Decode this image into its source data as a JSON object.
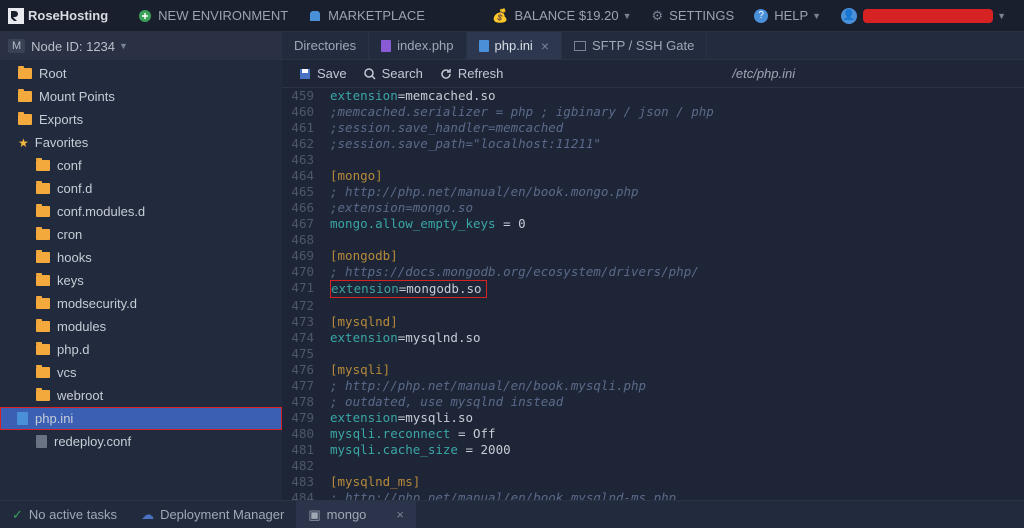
{
  "topbar": {
    "brand": "RoseHosting",
    "newEnv": "NEW ENVIRONMENT",
    "marketplace": "MARKETPLACE",
    "balanceLabel": "BALANCE $19.20",
    "settings": "SETTINGS",
    "help": "HELP"
  },
  "leftPanel": {
    "nodeChip": "M",
    "nodeLabel": "Node ID: 1234",
    "items": [
      {
        "type": "folder",
        "label": "Root",
        "level": 0
      },
      {
        "type": "folder",
        "label": "Mount Points",
        "level": 0
      },
      {
        "type": "folder",
        "label": "Exports",
        "level": 0
      },
      {
        "type": "fav",
        "label": "Favorites",
        "level": 0
      },
      {
        "type": "folder",
        "label": "conf",
        "level": 1
      },
      {
        "type": "folder",
        "label": "conf.d",
        "level": 1
      },
      {
        "type": "folder",
        "label": "conf.modules.d",
        "level": 1
      },
      {
        "type": "folder",
        "label": "cron",
        "level": 1
      },
      {
        "type": "folder",
        "label": "hooks",
        "level": 1
      },
      {
        "type": "folder",
        "label": "keys",
        "level": 1
      },
      {
        "type": "folder",
        "label": "modsecurity.d",
        "level": 1
      },
      {
        "type": "folder",
        "label": "modules",
        "level": 1
      },
      {
        "type": "folder",
        "label": "php.d",
        "level": 1
      },
      {
        "type": "folder",
        "label": "vcs",
        "level": 1
      },
      {
        "type": "folder",
        "label": "webroot",
        "level": 1
      },
      {
        "type": "file-blue",
        "label": "php.ini",
        "level": 1,
        "selected": true,
        "redbox": true
      },
      {
        "type": "file-grey",
        "label": "redeploy.conf",
        "level": 1
      }
    ]
  },
  "tabs": [
    {
      "label": "Directories",
      "icon": null
    },
    {
      "label": "index.php",
      "icon": "php"
    },
    {
      "label": "php.ini",
      "icon": "blue",
      "active": true,
      "closable": true
    },
    {
      "label": "SFTP / SSH Gate",
      "icon": "monitor"
    }
  ],
  "toolbar": {
    "save": "Save",
    "search": "Search",
    "refresh": "Refresh",
    "path": "/etc/php.ini"
  },
  "code": [
    {
      "n": 459,
      "tokens": [
        [
          "kw",
          "extension"
        ],
        [
          "op",
          "="
        ],
        [
          "val",
          "memcached.so"
        ]
      ]
    },
    {
      "n": 460,
      "tokens": [
        [
          "comment",
          ";memcached.serializer = php ; igbinary / json / php"
        ]
      ]
    },
    {
      "n": 461,
      "tokens": [
        [
          "comment",
          ";session.save_handler=memcached"
        ]
      ]
    },
    {
      "n": 462,
      "tokens": [
        [
          "comment",
          ";session.save_path=\"localhost:11211\""
        ]
      ]
    },
    {
      "n": 463,
      "tokens": []
    },
    {
      "n": 464,
      "tokens": [
        [
          "section",
          "[mongo]"
        ]
      ]
    },
    {
      "n": 465,
      "tokens": [
        [
          "comment",
          "; http://php.net/manual/en/book.mongo.php"
        ]
      ]
    },
    {
      "n": 466,
      "tokens": [
        [
          "comment",
          ";extension=mongo.so"
        ]
      ]
    },
    {
      "n": 467,
      "tokens": [
        [
          "kw",
          "mongo.allow_empty_keys"
        ],
        [
          "op",
          " = "
        ],
        [
          "num",
          "0"
        ]
      ]
    },
    {
      "n": 468,
      "tokens": []
    },
    {
      "n": 469,
      "tokens": [
        [
          "section",
          "[mongodb]"
        ]
      ]
    },
    {
      "n": 470,
      "tokens": [
        [
          "comment",
          "; https://docs.mongodb.org/ecosystem/drivers/php/"
        ]
      ]
    },
    {
      "n": 471,
      "highlight": true,
      "tokens": [
        [
          "kw",
          "extension"
        ],
        [
          "op",
          "="
        ],
        [
          "val",
          "mongodb.so"
        ]
      ]
    },
    {
      "n": 472,
      "tokens": []
    },
    {
      "n": 473,
      "tokens": [
        [
          "section",
          "[mysqlnd]"
        ]
      ]
    },
    {
      "n": 474,
      "tokens": [
        [
          "kw",
          "extension"
        ],
        [
          "op",
          "="
        ],
        [
          "val",
          "mysqlnd.so"
        ]
      ]
    },
    {
      "n": 475,
      "tokens": []
    },
    {
      "n": 476,
      "tokens": [
        [
          "section",
          "[mysqli]"
        ]
      ]
    },
    {
      "n": 477,
      "tokens": [
        [
          "comment",
          "; http://php.net/manual/en/book.mysqli.php"
        ]
      ]
    },
    {
      "n": 478,
      "tokens": [
        [
          "comment",
          "; outdated, use mysqlnd instead"
        ]
      ]
    },
    {
      "n": 479,
      "tokens": [
        [
          "kw",
          "extension"
        ],
        [
          "op",
          "="
        ],
        [
          "val",
          "mysqli.so"
        ]
      ]
    },
    {
      "n": 480,
      "tokens": [
        [
          "kw",
          "mysqli.reconnect"
        ],
        [
          "op",
          " = "
        ],
        [
          "val",
          "Off"
        ]
      ]
    },
    {
      "n": 481,
      "tokens": [
        [
          "kw",
          "mysqli.cache_size"
        ],
        [
          "op",
          " = "
        ],
        [
          "num",
          "2000"
        ]
      ]
    },
    {
      "n": 482,
      "tokens": []
    },
    {
      "n": 483,
      "tokens": [
        [
          "section",
          "[mysqlnd_ms]"
        ]
      ]
    },
    {
      "n": 484,
      "tokens": [
        [
          "comment",
          "; http://php.net/manual/en/book.mysqlnd-ms.php"
        ]
      ]
    }
  ],
  "bottombar": {
    "tasks": "No active tasks",
    "deploy": "Deployment Manager",
    "mongo": "mongo"
  }
}
